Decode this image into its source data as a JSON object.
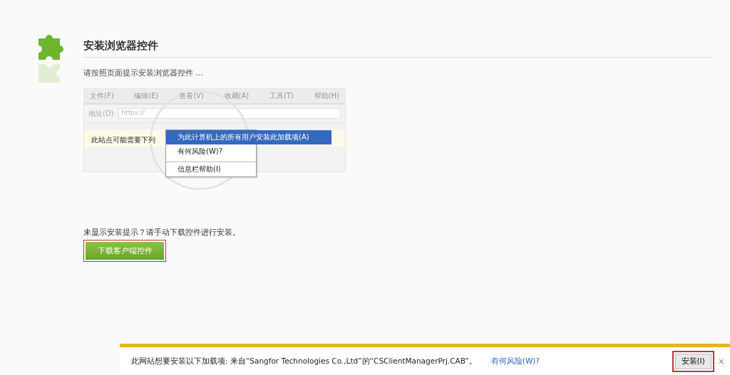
{
  "header": {
    "title": "安装浏览器控件",
    "subtitle": "请按照页面提示安装浏览器控件 ..."
  },
  "illustration": {
    "menu_bar": [
      "文件(F)",
      "编辑(E)",
      "查看(V)",
      "收藏(A)",
      "工具(T)",
      "帮助(H)"
    ],
    "address_label": "地址(D)",
    "address_value": "https://",
    "info_bar": "此站点可能需要下列",
    "context_menu": [
      {
        "label": "为此计算机上的所有用户安装此加载项(A)",
        "selected": true
      },
      {
        "label": "有何风险(W)?",
        "selected": false
      },
      {
        "label": "信息栏帮助(I)",
        "selected": false
      }
    ]
  },
  "manual": {
    "hint": "未显示安装提示？请手动下载控件进行安装。",
    "button": "下载客户端控件",
    "highlighted": true
  },
  "notification_bar": {
    "message": "此网站想要安装以下加载项: 来自“Sangfor Technologies Co.,Ltd”的“CSClientManagerPrj.CAB”。",
    "link": "有何风险(W)?",
    "install_button": "安装(I)",
    "install_highlighted": true,
    "close": "×"
  }
}
